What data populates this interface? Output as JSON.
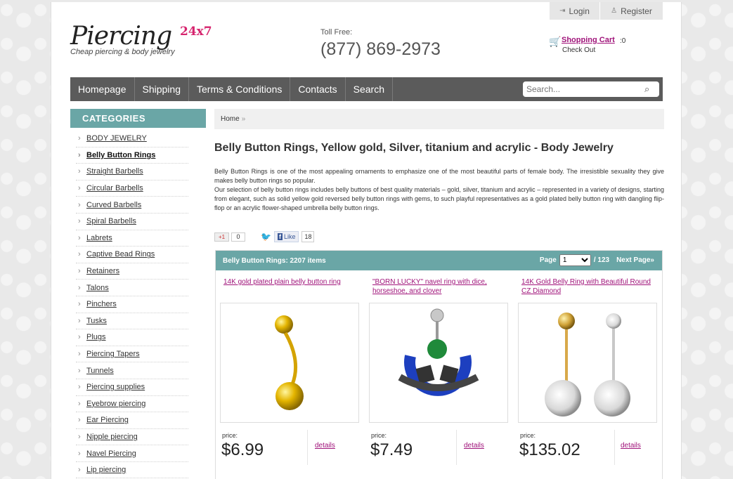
{
  "header": {
    "login": "Login",
    "register": "Register",
    "logo_main": "Piercing",
    "logo_sup": "24x7",
    "logo_tagline": "Cheap piercing & body jewelry",
    "toll_label": "Toll Free:",
    "toll_phone": "(877) 869-2973",
    "cart_label": "Shopping Cart",
    "cart_count": ":0",
    "checkout": "Check Out"
  },
  "nav": {
    "items": [
      "Homepage",
      "Shipping",
      "Terms & Conditions",
      "Contacts",
      "Search"
    ],
    "search_placeholder": "Search..."
  },
  "sidebar": {
    "title": "CATEGORIES",
    "items": [
      "BODY JEWELRY",
      "Belly Button Rings",
      "Straight Barbells",
      "Circular Barbells",
      "Curved Barbells",
      "Spiral Barbells",
      "Labrets",
      "Captive Bead Rings",
      "Retainers",
      "Talons",
      "Pinchers",
      "Tusks",
      "Plugs",
      "Piercing Tapers",
      "Tunnels",
      "Piercing supplies",
      "Eyebrow piercing",
      "Ear Piercing",
      "Nipple piercing",
      "Navel Piercing",
      "Lip piercing"
    ],
    "active_index": 1
  },
  "main": {
    "breadcrumb_home": "Home",
    "breadcrumb_sep": "»",
    "title": "Belly Button Rings, Yellow gold, Silver, titanium and acrylic - Body Jewelry",
    "desc1": "Belly Button Rings is one of the most appealing ornaments to emphasize one of the most beautiful parts of female body. The irresistible sexuality they give makes belly button rings so popular.",
    "desc2": "Our selection of belly button rings includes belly buttons of best quality materials – gold, silver, titanium and acrylic – represented in a variety of designs, starting from elegant, such as solid yellow gold reversed belly button rings with gems, to such playful representatives as a gold plated belly button ring with dangling flip-flop or an acrylic flower-shaped umbrella belly button rings.",
    "gplus_label": "+1",
    "gplus_count": "0",
    "fb_like": "Like",
    "fb_count": "18"
  },
  "products": {
    "bar_label": "Belly Button Rings: 2207 items",
    "page_label": "Page",
    "page_value": "1",
    "page_total": "/ 123",
    "next_label": "Next Page»",
    "price_label": "price:",
    "details_label": "details",
    "items": [
      {
        "name": "14K gold plated plain belly button ring",
        "price": "$6.99"
      },
      {
        "name": "\"BORN LUCKY\" navel ring with dice, horseshoe, and clover",
        "price": "$7.49"
      },
      {
        "name": "14K Gold Belly Ring with Beautiful Round CZ Diamond",
        "price": "$135.02"
      }
    ]
  }
}
